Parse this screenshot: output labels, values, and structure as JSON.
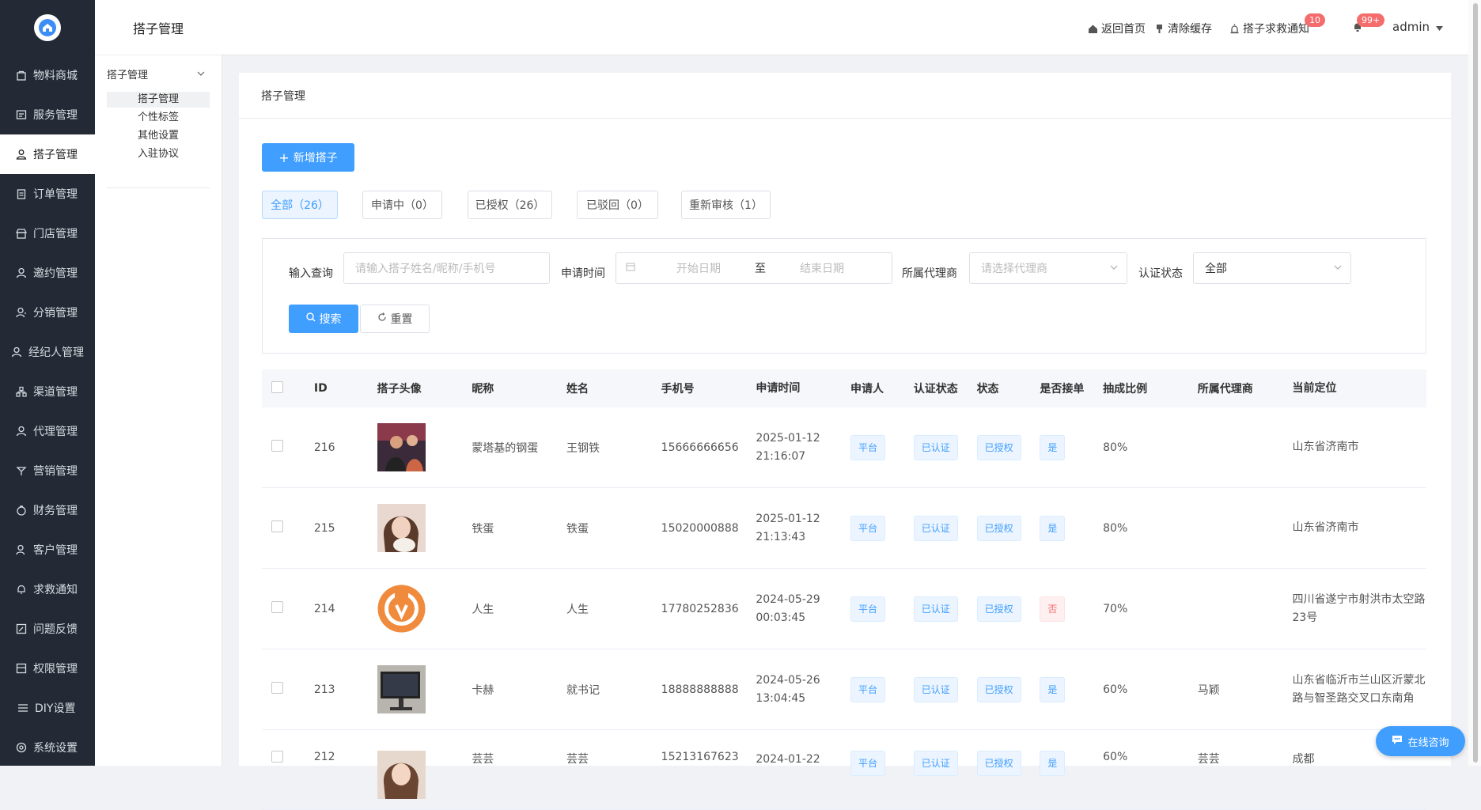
{
  "sidebar": {
    "items": [
      {
        "label": "物料商城",
        "icon": "bag-icon"
      },
      {
        "label": "服务管理",
        "icon": "service-icon"
      },
      {
        "label": "搭子管理",
        "icon": "person-icon"
      },
      {
        "label": "订单管理",
        "icon": "clipboard-icon"
      },
      {
        "label": "门店管理",
        "icon": "store-icon"
      },
      {
        "label": "邀约管理",
        "icon": "user-icon"
      },
      {
        "label": "分销管理",
        "icon": "share-user-icon"
      },
      {
        "label": "经纪人管理",
        "icon": "agent-icon"
      },
      {
        "label": "渠道管理",
        "icon": "channel-icon"
      },
      {
        "label": "代理管理",
        "icon": "proxy-icon"
      },
      {
        "label": "营销管理",
        "icon": "marketing-icon"
      },
      {
        "label": "财务管理",
        "icon": "wallet-icon"
      },
      {
        "label": "客户管理",
        "icon": "customers-icon"
      },
      {
        "label": "求救通知",
        "icon": "bell-icon"
      },
      {
        "label": "问题反馈",
        "icon": "edit-icon"
      },
      {
        "label": "权限管理",
        "icon": "permission-icon"
      },
      {
        "label": "DIY设置",
        "icon": "diy-icon"
      },
      {
        "label": "系统设置",
        "icon": "gear-icon"
      }
    ]
  },
  "submenu": {
    "title": "搭子管理",
    "group": "搭子管理",
    "items": [
      "搭子管理",
      "个性标签",
      "其他设置",
      "入驻协议"
    ]
  },
  "header": {
    "home": "返回首页",
    "clear_cache": "清除缓存",
    "sos": "搭子求救通知",
    "sos_badge": "10",
    "bell_badge": "99+",
    "user": "admin"
  },
  "page": {
    "title": "搭子管理",
    "add_button": "新增搭子",
    "tabs": [
      "全部（26）",
      "申请中（0）",
      "已授权（26）",
      "已驳回（0）",
      "重新审核（1）"
    ]
  },
  "search": {
    "query_label": "输入查询",
    "query_placeholder": "请输入搭子姓名/昵称/手机号",
    "time_label": "申请时间",
    "start_placeholder": "开始日期",
    "range_sep": "至",
    "end_placeholder": "结束日期",
    "agent_label": "所属代理商",
    "agent_placeholder": "请选择代理商",
    "auth_label": "认证状态",
    "auth_value": "全部",
    "search_button": "搜索",
    "reset_button": "重置"
  },
  "table": {
    "headers": [
      "ID",
      "搭子头像",
      "昵称",
      "姓名",
      "手机号",
      "申请时间",
      "申请人",
      "认证状态",
      "状态",
      "是否接单",
      "抽成比例",
      "所属代理商",
      "当前定位"
    ],
    "rows": [
      {
        "id": "216",
        "nick": "蒙塔基的钢蛋",
        "name": "王钢铁",
        "phone": "15666666656",
        "date": "2025-01-12",
        "time": "21:16:07",
        "applicant": "平台",
        "auth": "已认证",
        "status": "已授权",
        "accept": "是",
        "ratio": "80%",
        "agent": "",
        "loc1": "山东省济南市",
        "loc2": ""
      },
      {
        "id": "215",
        "nick": "铁蛋",
        "name": "铁蛋",
        "phone": "15020000888",
        "date": "2025-01-12",
        "time": "21:13:43",
        "applicant": "平台",
        "auth": "已认证",
        "status": "已授权",
        "accept": "是",
        "ratio": "80%",
        "agent": "",
        "loc1": "山东省济南市",
        "loc2": ""
      },
      {
        "id": "214",
        "nick": "人生",
        "name": "人生",
        "phone": "17780252836",
        "date": "2024-05-29",
        "time": "00:03:45",
        "applicant": "平台",
        "auth": "已认证",
        "status": "已授权",
        "accept": "否",
        "ratio": "70%",
        "agent": "",
        "loc1": "四川省遂宁市射洪市太空路",
        "loc2": "23号"
      },
      {
        "id": "213",
        "nick": "卡赫",
        "name": "就书记",
        "phone": "18888888888",
        "date": "2024-05-26",
        "time": "13:04:45",
        "applicant": "平台",
        "auth": "已认证",
        "status": "已授权",
        "accept": "是",
        "ratio": "60%",
        "agent": "马颖",
        "loc1": "山东省临沂市兰山区沂蒙北",
        "loc2": "路与智圣路交叉口东南角"
      },
      {
        "id": "212",
        "nick": "芸芸",
        "name": "芸芸",
        "phone": "15213167623",
        "date": "2024-01-22",
        "time": "",
        "applicant": "平台",
        "auth": "已认证",
        "status": "已授权",
        "accept": "是",
        "ratio": "60%",
        "agent": "芸芸",
        "loc1": "成都",
        "loc2": ""
      }
    ]
  },
  "chat": {
    "label": "在线咨询"
  },
  "colors": {
    "primary": "#409eff",
    "sidebar": "#232a35",
    "danger": "#f56c6c"
  }
}
